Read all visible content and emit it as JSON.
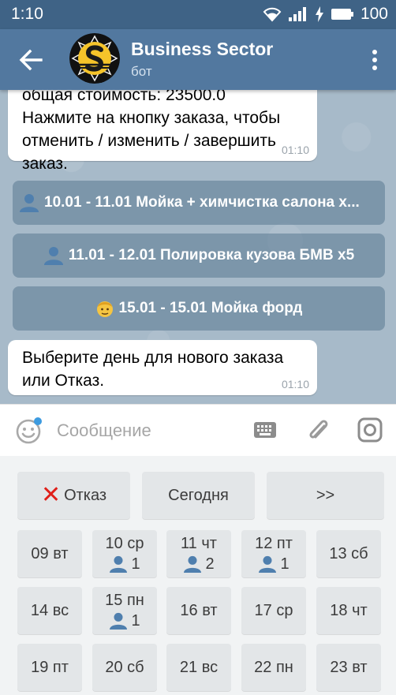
{
  "status_bar": {
    "time": "1:10",
    "battery": "100",
    "icons": [
      "wifi-icon",
      "signal-icon",
      "charging-icon",
      "battery-icon"
    ]
  },
  "app_bar": {
    "title": "Business Sector",
    "subtitle": "бот",
    "avatar_icon": "business-sector-logo"
  },
  "messages": [
    {
      "text": "общая стоимость: 23500.0\nНажмите на кнопку заказа, чтобы отменить / изменить / завершить заказ.",
      "time": "01:10"
    },
    {
      "text": "Выберите день для нового заказа или Отказ.",
      "time": "01:10"
    }
  ],
  "inline_buttons": [
    {
      "icon": "person-icon",
      "label": "10.01 - 11.01 Мойка + химчистка салона х..."
    },
    {
      "icon": "person-icon",
      "label": "11.01 - 12.01 Полировка кузова БМВ х5"
    },
    {
      "icon": "face-icon",
      "label": "15.01 - 15.01 Мойка форд"
    }
  ],
  "input": {
    "placeholder": "Сообщение"
  },
  "keyboard": {
    "top_row": [
      {
        "label": "Отказ",
        "icon": "x-icon"
      },
      {
        "label": "Сегодня"
      },
      {
        "label": ">>"
      }
    ],
    "days": [
      {
        "label": "09 вт"
      },
      {
        "label": "10 ср",
        "count": "1",
        "icon": "person-icon"
      },
      {
        "label": "11 чт",
        "count": "2",
        "icon": "person-icon"
      },
      {
        "label": "12 пт",
        "count": "1",
        "icon": "person-icon"
      },
      {
        "label": "13 сб"
      },
      {
        "label": "14 вс"
      },
      {
        "label": "15 пн",
        "count": "1",
        "icon": "person-icon"
      },
      {
        "label": "16 вт"
      },
      {
        "label": "17 ср"
      },
      {
        "label": "18 чт"
      },
      {
        "label": "19 пт"
      },
      {
        "label": "20 сб"
      },
      {
        "label": "21 вс"
      },
      {
        "label": "22 пн"
      },
      {
        "label": "23 вт"
      }
    ]
  },
  "colors": {
    "app_bar": "#52789f",
    "status_bar": "#3f6386",
    "chat_background": "#a7bac9",
    "inline_button": "#637f98",
    "person_icon": "#4f7fae",
    "cancel_x": "#e0201a",
    "emoji_badge": "#3d9be0"
  }
}
